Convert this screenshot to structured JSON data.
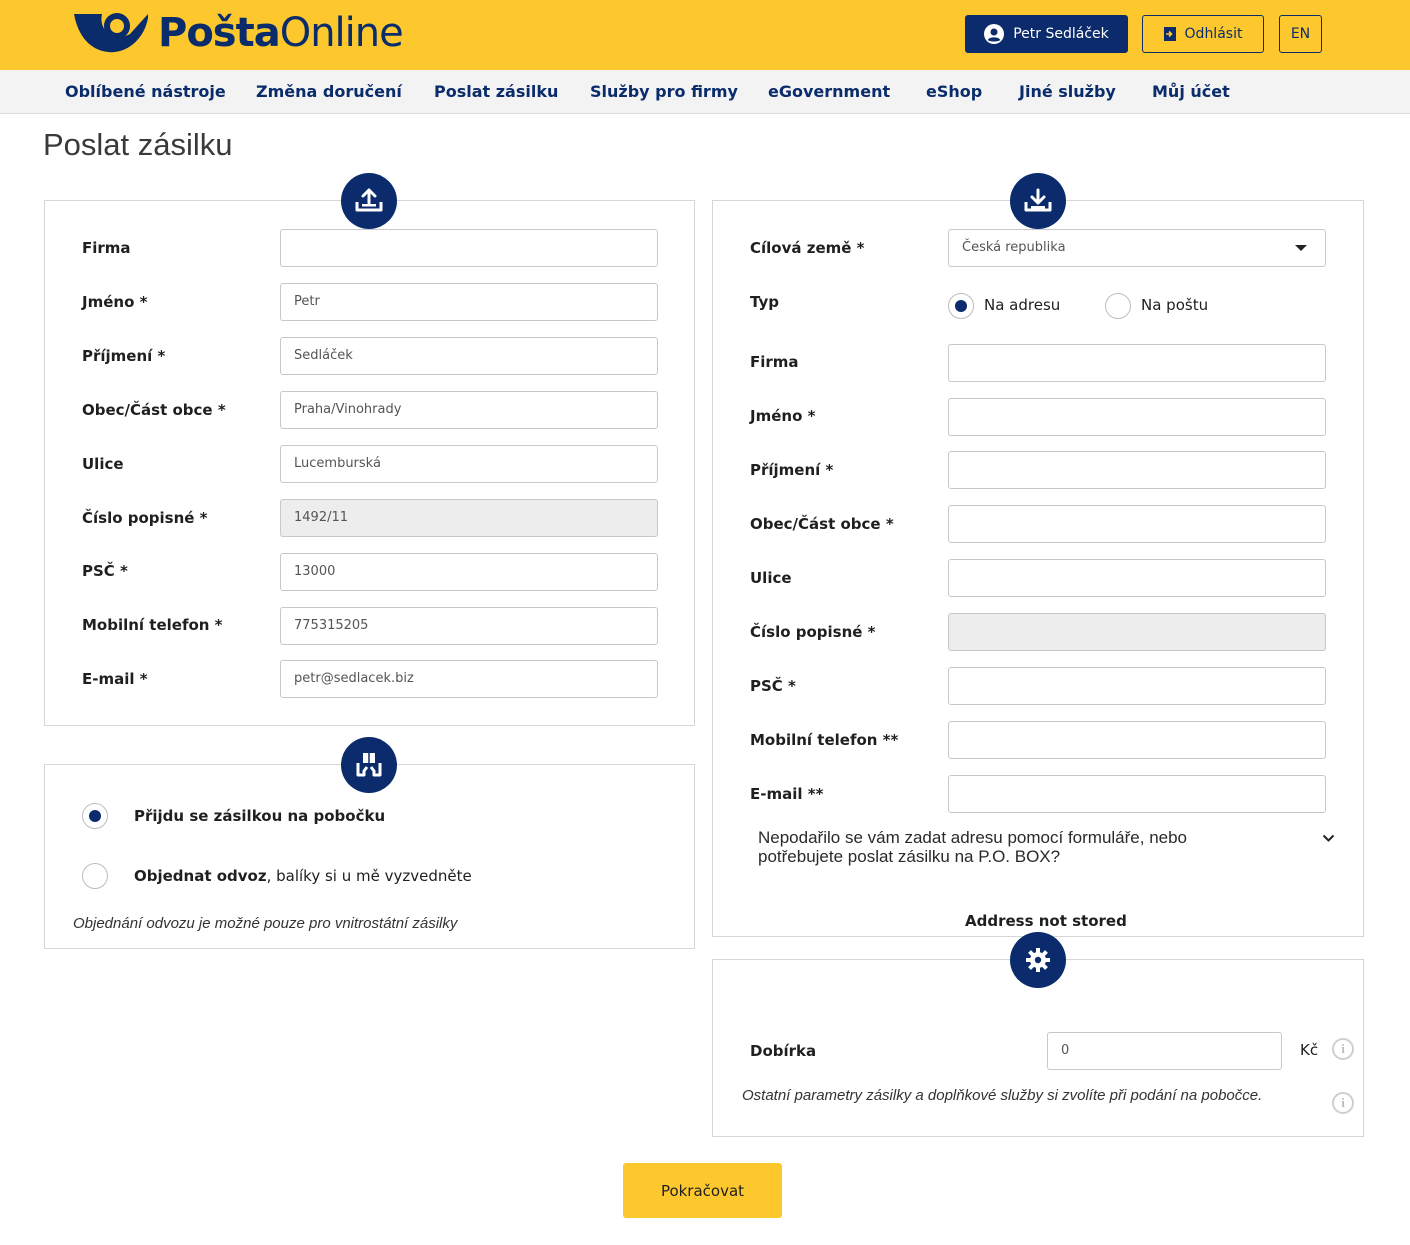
{
  "header": {
    "logo_bold": "Pošta",
    "logo_light": "Online",
    "user_name": "Petr Sedláček",
    "logout_label": "Odhlásit",
    "lang_label": "EN",
    "user_icon": "user-circle-icon",
    "logout_icon": "logout-icon"
  },
  "nav": {
    "items": [
      "Oblíbené nástroje",
      "Změna doručení",
      "Poslat zásilku",
      "Služby pro firmy",
      "eGovernment",
      "eShop",
      "Jiné služby",
      "Můj účet"
    ]
  },
  "page": {
    "title": "Poslat zásilku"
  },
  "sender": {
    "icon": "upload-icon",
    "fields": [
      {
        "label": "Firma",
        "value": ""
      },
      {
        "label": "Jméno *",
        "value": "Petr"
      },
      {
        "label": "Příjmení *",
        "value": "Sedláček"
      },
      {
        "label": "Obec/Část obce *",
        "value": "Praha/Vinohrady"
      },
      {
        "label": "Ulice",
        "value": "Lucemburská"
      },
      {
        "label": "Číslo popisné *",
        "value": "1492/11"
      },
      {
        "label": "PSČ *",
        "value": "13000"
      },
      {
        "label": "Mobilní telefon *",
        "value": "775315205"
      },
      {
        "label": "E-mail *",
        "value": "petr@sedlacek.biz"
      }
    ]
  },
  "handover": {
    "icon": "parcel-handover-icon",
    "option1": "Přijdu se zásilkou na pobočku",
    "option2_bold": "Objednat odvoz",
    "option2_rest": ", balíky si u mě vyzvedněte",
    "note": "Objednání odvozu je možné pouze pro vnitrostátní zásilky"
  },
  "recipient": {
    "icon": "download-icon",
    "country_label": "Cílová země *",
    "country_value": "Česká republika",
    "type_label": "Typ",
    "type_option1": "Na adresu",
    "type_option2": "Na poštu",
    "fields": [
      {
        "label": "Firma",
        "value": ""
      },
      {
        "label": "Jméno *",
        "value": ""
      },
      {
        "label": "Příjmení *",
        "value": ""
      },
      {
        "label": "Obec/Část obce *",
        "value": ""
      },
      {
        "label": "Ulice",
        "value": ""
      },
      {
        "label": "Číslo popisné *",
        "value": ""
      },
      {
        "label": "PSČ *",
        "value": ""
      },
      {
        "label": "Mobilní telefon **",
        "value": ""
      },
      {
        "label": "E-mail **",
        "value": ""
      }
    ],
    "pobox_line1": "Nepodařilo se vám zadat adresu pomocí formuláře, nebo",
    "pobox_line2": "potřebujete poslat zásilku na P.O. BOX?",
    "status": "Address not stored"
  },
  "options": {
    "icon": "gear-icon",
    "cod_label": "Dobírka",
    "cod_value": "0",
    "currency": "Kč",
    "note": "Ostatní parametry zásilky a doplňkové služby si zvolíte při podání na pobočce."
  },
  "continue_label": "Pokračovat"
}
